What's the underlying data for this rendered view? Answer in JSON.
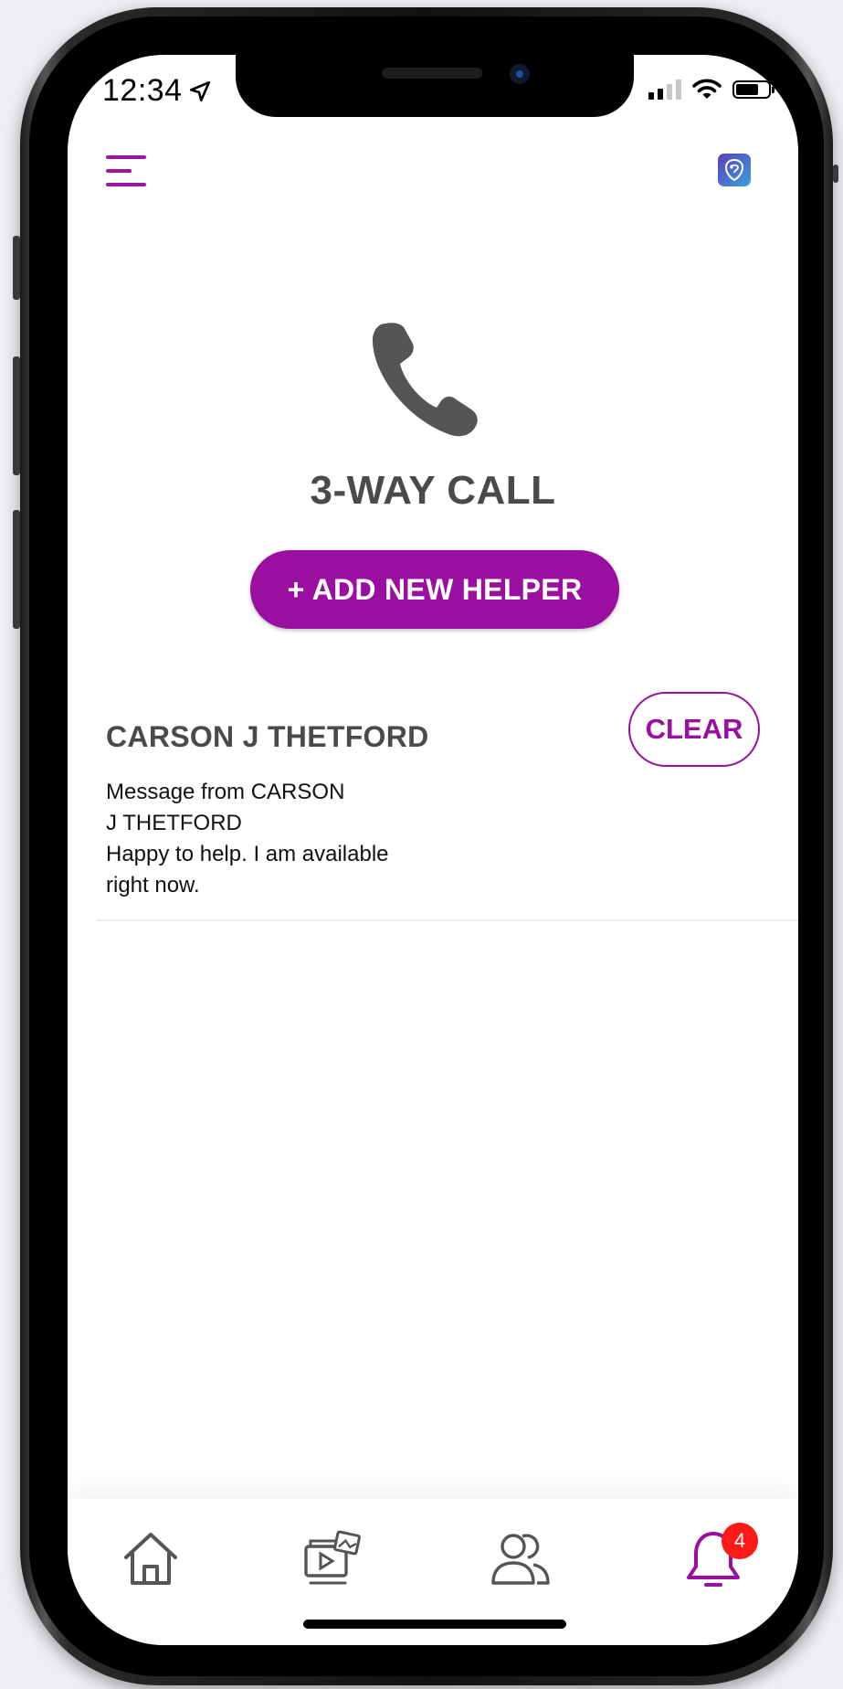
{
  "status_bar": {
    "time": "12:34"
  },
  "header": {
    "menu_icon": "hamburger-menu-icon",
    "logo_icon": "app-logo-icon"
  },
  "main": {
    "hero_icon": "phone-handset-icon",
    "title": "3-WAY CALL",
    "add_button_label": "+ ADD NEW HELPER"
  },
  "helpers": [
    {
      "name": "CARSON J THETFORD",
      "clear_label": "CLEAR",
      "message_lines": [
        "Message from CARSON",
        "J THETFORD",
        "Happy to help. I am available",
        "right now."
      ]
    }
  ],
  "tab_bar": {
    "tabs": [
      {
        "name": "home",
        "icon": "home-icon"
      },
      {
        "name": "media",
        "icon": "media-gallery-icon"
      },
      {
        "name": "contacts",
        "icon": "people-icon"
      },
      {
        "name": "notifications",
        "icon": "bell-icon",
        "badge": "4"
      }
    ]
  },
  "colors": {
    "accent": "#9a0fa0",
    "text_dark": "#4a4a4a",
    "badge": "#ff1a1a"
  }
}
